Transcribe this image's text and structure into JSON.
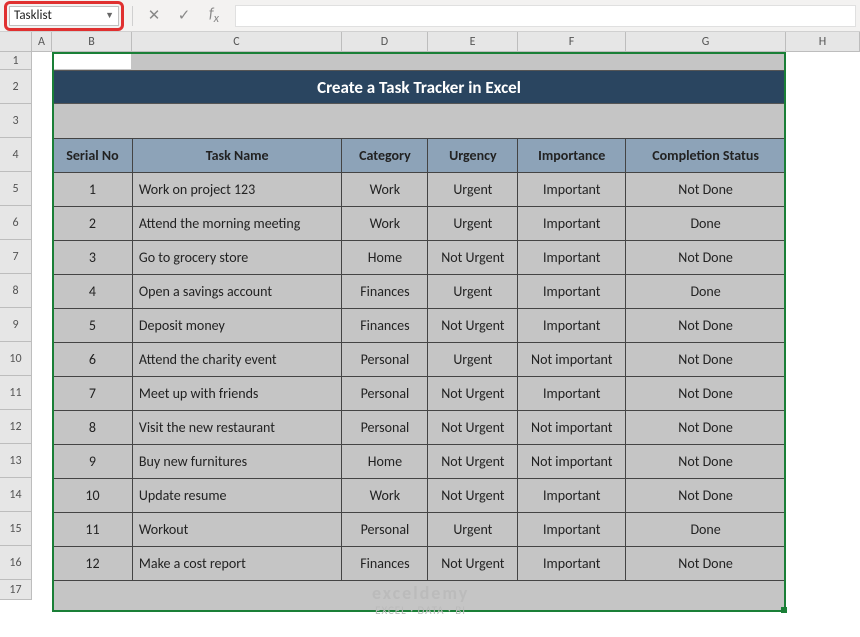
{
  "nameBox": "Tasklist",
  "title": "Create a Task Tracker in Excel",
  "columns": [
    "",
    "A",
    "B",
    "C",
    "D",
    "E",
    "F",
    "G",
    "H"
  ],
  "rowNumbers": [
    "1",
    "2",
    "3",
    "4",
    "5",
    "6",
    "7",
    "8",
    "9",
    "10",
    "11",
    "12",
    "13",
    "14",
    "15",
    "16",
    "17"
  ],
  "headers": {
    "serial": "Serial No",
    "task": "Task Name",
    "category": "Category",
    "urgency": "Urgency",
    "importance": "Importance",
    "status": "Completion Status"
  },
  "tasks": [
    {
      "serial": "1",
      "name": "Work on project 123",
      "category": "Work",
      "urgency": "Urgent",
      "importance": "Important",
      "status": "Not Done"
    },
    {
      "serial": "2",
      "name": "Attend the morning meeting",
      "category": "Work",
      "urgency": "Urgent",
      "importance": "Important",
      "status": "Done"
    },
    {
      "serial": "3",
      "name": "Go to grocery store",
      "category": "Home",
      "urgency": "Not Urgent",
      "importance": "Important",
      "status": "Not Done"
    },
    {
      "serial": "4",
      "name": "Open a savings account",
      "category": "Finances",
      "urgency": "Urgent",
      "importance": "Important",
      "status": "Done"
    },
    {
      "serial": "5",
      "name": "Deposit money",
      "category": "Finances",
      "urgency": "Not Urgent",
      "importance": "Important",
      "status": "Not Done"
    },
    {
      "serial": "6",
      "name": "Attend the charity event",
      "category": "Personal",
      "urgency": "Urgent",
      "importance": "Not important",
      "status": "Not Done"
    },
    {
      "serial": "7",
      "name": "Meet up with friends",
      "category": "Personal",
      "urgency": "Not Urgent",
      "importance": "Important",
      "status": "Not Done"
    },
    {
      "serial": "8",
      "name": "Visit the new restaurant",
      "category": "Personal",
      "urgency": "Not Urgent",
      "importance": "Not important",
      "status": "Not Done"
    },
    {
      "serial": "9",
      "name": "Buy new furnitures",
      "category": "Home",
      "urgency": "Not Urgent",
      "importance": "Not important",
      "status": "Not Done"
    },
    {
      "serial": "10",
      "name": "Update resume",
      "category": "Work",
      "urgency": "Not Urgent",
      "importance": "Important",
      "status": "Not Done"
    },
    {
      "serial": "11",
      "name": "Workout",
      "category": "Personal",
      "urgency": "Urgent",
      "importance": "Important",
      "status": "Done"
    },
    {
      "serial": "12",
      "name": "Make a cost report",
      "category": "Finances",
      "urgency": "Not Urgent",
      "importance": "Important",
      "status": "Not Done"
    }
  ],
  "watermark": {
    "brand": "exceldemy",
    "tagline": "EXCEL · DATA · BI"
  }
}
